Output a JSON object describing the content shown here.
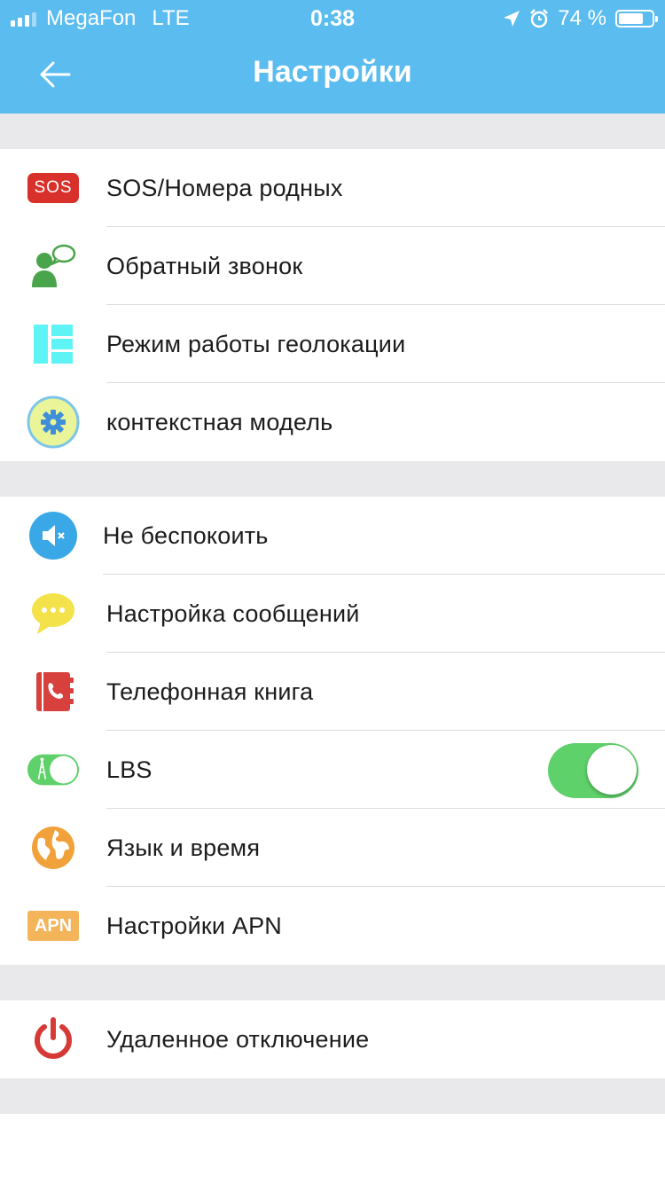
{
  "status_bar": {
    "carrier": "MegaFon",
    "network": "LTE",
    "time": "0:38",
    "battery_text": "74 %",
    "battery_level": 0.74
  },
  "nav": {
    "title": "Настройки"
  },
  "sos_badge": "SOS",
  "apn_badge": "APN",
  "groups": [
    {
      "items": [
        {
          "label": "SOS/Номера родных",
          "icon": "sos-icon"
        },
        {
          "label": "Обратный звонок",
          "icon": "callback-icon"
        },
        {
          "label": "Режим работы геолокации",
          "icon": "location-mode-icon"
        },
        {
          "label": "контекстная модель",
          "icon": "gear-icon"
        }
      ]
    },
    {
      "items": [
        {
          "label": "Не беспокоить",
          "icon": "mute-icon"
        },
        {
          "label": "Настройка сообщений",
          "icon": "chat-icon"
        },
        {
          "label": "Телефонная книга",
          "icon": "phonebook-icon"
        },
        {
          "label": "LBS",
          "icon": "lbs-toggle-icon",
          "toggle_on": true
        },
        {
          "label": "Язык и время",
          "icon": "globe-icon"
        },
        {
          "label": "Настройки APN",
          "icon": "apn-icon"
        }
      ]
    },
    {
      "items": [
        {
          "label": "Удаленное отключение",
          "icon": "power-icon"
        }
      ]
    }
  ],
  "colors": {
    "header": "#5bbcf0",
    "toggle_on": "#5fd16a",
    "separator_bg": "#e9e8ea"
  }
}
